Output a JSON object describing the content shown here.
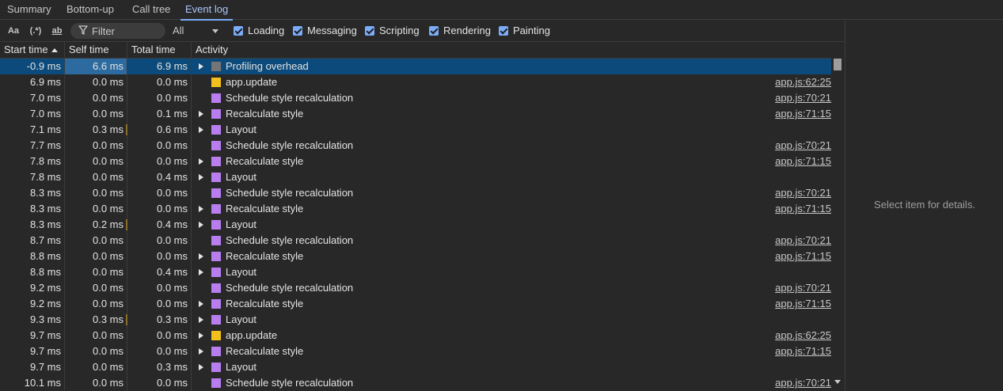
{
  "tabs": [
    {
      "label": "Summary",
      "active": false
    },
    {
      "label": "Bottom-up",
      "active": false
    },
    {
      "label": "Call tree",
      "active": false
    },
    {
      "label": "Event log",
      "active": true
    }
  ],
  "toolbar": {
    "match_case_label": "Aa",
    "regex_label": "(.*)",
    "whole_word_label": "ab",
    "filter_placeholder": "Filter",
    "filter_value": "",
    "level_value": "All",
    "checkboxes": [
      {
        "label": "Loading",
        "checked": true
      },
      {
        "label": "Messaging",
        "checked": true
      },
      {
        "label": "Scripting",
        "checked": true
      },
      {
        "label": "Rendering",
        "checked": true
      },
      {
        "label": "Painting",
        "checked": true
      }
    ]
  },
  "colors": {
    "accent": "#7cacf8",
    "selection": "#0b4a7a",
    "profiling_overhead": "#757575",
    "scripting": "#f2c01e",
    "rendering": "#b87ef0"
  },
  "table": {
    "columns": {
      "start_time": "Start time",
      "self_time": "Self time",
      "total_time": "Total time",
      "activity": "Activity"
    },
    "sort_column": "start_time",
    "sort_direction": "ascending",
    "rows": [
      {
        "start": "-0.9 ms",
        "self": "6.6 ms",
        "total": "6.9 ms",
        "activity": "Profiling overhead",
        "category": "profiling_overhead",
        "expandable": true,
        "source": "",
        "selected": true
      },
      {
        "start": "6.9 ms",
        "self": "0.0 ms",
        "total": "0.0 ms",
        "activity": "app.update",
        "category": "scripting",
        "expandable": false,
        "source": "app.js:62:25"
      },
      {
        "start": "7.0 ms",
        "self": "0.0 ms",
        "total": "0.0 ms",
        "activity": "Schedule style recalculation",
        "category": "rendering",
        "expandable": false,
        "source": "app.js:70:21"
      },
      {
        "start": "7.0 ms",
        "self": "0.0 ms",
        "total": "0.1 ms",
        "activity": "Recalculate style",
        "category": "rendering",
        "expandable": true,
        "source": "app.js:71:15"
      },
      {
        "start": "7.1 ms",
        "self": "0.3 ms",
        "total": "0.6 ms",
        "activity": "Layout",
        "category": "rendering",
        "expandable": true,
        "source": "",
        "self_bar": true
      },
      {
        "start": "7.7 ms",
        "self": "0.0 ms",
        "total": "0.0 ms",
        "activity": "Schedule style recalculation",
        "category": "rendering",
        "expandable": false,
        "source": "app.js:70:21"
      },
      {
        "start": "7.8 ms",
        "self": "0.0 ms",
        "total": "0.0 ms",
        "activity": "Recalculate style",
        "category": "rendering",
        "expandable": true,
        "source": "app.js:71:15"
      },
      {
        "start": "7.8 ms",
        "self": "0.0 ms",
        "total": "0.4 ms",
        "activity": "Layout",
        "category": "rendering",
        "expandable": true,
        "source": ""
      },
      {
        "start": "8.3 ms",
        "self": "0.0 ms",
        "total": "0.0 ms",
        "activity": "Schedule style recalculation",
        "category": "rendering",
        "expandable": false,
        "source": "app.js:70:21"
      },
      {
        "start": "8.3 ms",
        "self": "0.0 ms",
        "total": "0.0 ms",
        "activity": "Recalculate style",
        "category": "rendering",
        "expandable": true,
        "source": "app.js:71:15"
      },
      {
        "start": "8.3 ms",
        "self": "0.2 ms",
        "total": "0.4 ms",
        "activity": "Layout",
        "category": "rendering",
        "expandable": true,
        "source": "",
        "self_bar": true
      },
      {
        "start": "8.7 ms",
        "self": "0.0 ms",
        "total": "0.0 ms",
        "activity": "Schedule style recalculation",
        "category": "rendering",
        "expandable": false,
        "source": "app.js:70:21"
      },
      {
        "start": "8.8 ms",
        "self": "0.0 ms",
        "total": "0.0 ms",
        "activity": "Recalculate style",
        "category": "rendering",
        "expandable": true,
        "source": "app.js:71:15"
      },
      {
        "start": "8.8 ms",
        "self": "0.0 ms",
        "total": "0.4 ms",
        "activity": "Layout",
        "category": "rendering",
        "expandable": true,
        "source": ""
      },
      {
        "start": "9.2 ms",
        "self": "0.0 ms",
        "total": "0.0 ms",
        "activity": "Schedule style recalculation",
        "category": "rendering",
        "expandable": false,
        "source": "app.js:70:21"
      },
      {
        "start": "9.2 ms",
        "self": "0.0 ms",
        "total": "0.0 ms",
        "activity": "Recalculate style",
        "category": "rendering",
        "expandable": true,
        "source": "app.js:71:15"
      },
      {
        "start": "9.3 ms",
        "self": "0.3 ms",
        "total": "0.3 ms",
        "activity": "Layout",
        "category": "rendering",
        "expandable": true,
        "source": "",
        "self_bar": true
      },
      {
        "start": "9.7 ms",
        "self": "0.0 ms",
        "total": "0.0 ms",
        "activity": "app.update",
        "category": "scripting",
        "expandable": true,
        "source": "app.js:62:25"
      },
      {
        "start": "9.7 ms",
        "self": "0.0 ms",
        "total": "0.0 ms",
        "activity": "Recalculate style",
        "category": "rendering",
        "expandable": true,
        "source": "app.js:71:15"
      },
      {
        "start": "9.7 ms",
        "self": "0.0 ms",
        "total": "0.3 ms",
        "activity": "Layout",
        "category": "rendering",
        "expandable": true,
        "source": ""
      },
      {
        "start": "10.1 ms",
        "self": "0.0 ms",
        "total": "0.0 ms",
        "activity": "Schedule style recalculation",
        "category": "rendering",
        "expandable": false,
        "source": "app.js:70:21"
      }
    ]
  },
  "details": {
    "empty_message": "Select item for details."
  }
}
